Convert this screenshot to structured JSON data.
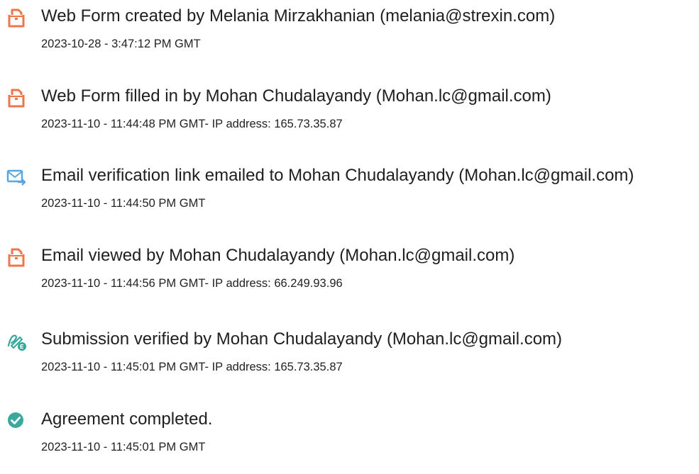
{
  "colors": {
    "doc_icon": "#f0764a",
    "email_icon": "#5aa6e0",
    "verified_icon": "#33a79a",
    "completed_icon": "#3aa89c",
    "text": "#1f1f1f"
  },
  "events": [
    {
      "icon": "document-icon",
      "title": "Web Form created by Melania Mirzakhanian (melania@strexin.com)",
      "meta": "2023-10-28 - 3:47:12 PM GMT"
    },
    {
      "icon": "document-icon",
      "title": "Web Form filled in by Mohan Chudalayandy (Mohan.lc@gmail.com)",
      "meta": "2023-11-10 - 11:44:48 PM GMT- IP address: 165.73.35.87"
    },
    {
      "icon": "email-send-icon",
      "title": "Email verification link emailed to Mohan Chudalayandy (Mohan.lc@gmail.com)",
      "meta": "2023-11-10 - 11:44:50 PM GMT"
    },
    {
      "icon": "document-icon",
      "title": "Email viewed by Mohan Chudalayandy (Mohan.lc@gmail.com)",
      "meta": "2023-11-10 - 11:44:56 PM GMT- IP address: 66.249.93.96"
    },
    {
      "icon": "signature-verified-icon",
      "title": "Submission verified by Mohan Chudalayandy (Mohan.lc@gmail.com)",
      "meta": "2023-11-10 - 11:45:01 PM GMT- IP address: 165.73.35.87"
    },
    {
      "icon": "check-circle-icon",
      "title": "Agreement completed.",
      "meta": "2023-11-10 - 11:45:01 PM GMT"
    }
  ]
}
